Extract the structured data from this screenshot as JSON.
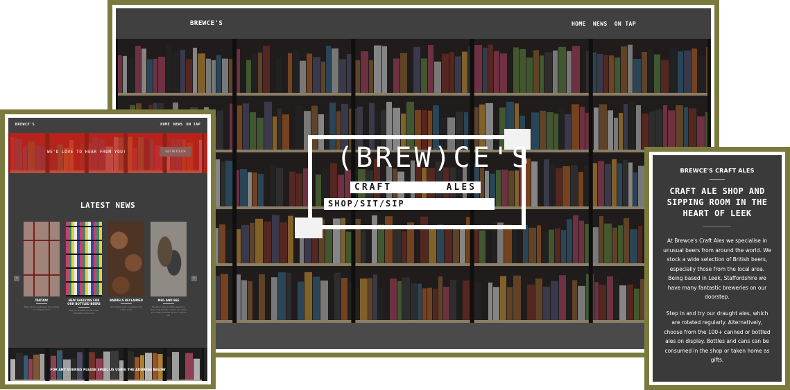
{
  "desktop": {
    "brand": "BREWCE'S",
    "nav": [
      "HOME",
      "NEWS",
      "ON TAP"
    ],
    "logo": {
      "title": "(BREW)CE'S",
      "line1": "CRAFT ALES",
      "line2": "SHOP/SIT/SIP"
    }
  },
  "tablet": {
    "brand": "BREWCE'S",
    "nav": [
      "HOME",
      "NEWS",
      "ON TAP"
    ],
    "banner_text": "WE'D LOVE TO HEAR FROM YOU!",
    "banner_button": "GET IN TOUCH",
    "section_title": "LATEST NEWS",
    "cards": [
      {
        "title": "TARTAN!",
        "desc": "Tasty tartan wallpaper decorating our tasting room"
      },
      {
        "title": "NEW SHELVING FOR OUR BOTTLED BEERS",
        "desc": "Easy to browse and as usual stocked to the max"
      },
      {
        "title": "BARRELS RECLAIMED",
        "desc": "Old new barrels converted into rustic seats"
      },
      {
        "title": "MEG AND BEE",
        "desc": "Together Meg and Bee welcome Beer dog friendly, watch you drink your beer and see all your friends up."
      }
    ],
    "arrow_left": "‹",
    "arrow_right": "›",
    "footer_note": "FOR ANY QUERIES PLEASE EMAIL US USING THE ADDRESS BELOW"
  },
  "phone": {
    "heading": "BREWCE'S CRAFT ALES",
    "title": "CRAFT ALE SHOP AND SIPPING ROOM IN THE HEART OF LEEK",
    "paragraph1": "At Brewce's Craft Ales we specialise in unusual beers from around the world. We stock a wide selection of British beers, especially those from the local area. Being based in Leek, Staffordshire we have many fantastic breweries on our doorstep.",
    "paragraph2": "Step in and try our draught ales, which are rotated regularly. Alternatively, choose from the 100+ canned or bottled ales on display. Bottles and cans can be consumed in the shop or taken home as gifts."
  },
  "colors": {
    "frame": "#7a7a3e",
    "screen": "#3d3d3d",
    "banner": "#b1231b"
  }
}
